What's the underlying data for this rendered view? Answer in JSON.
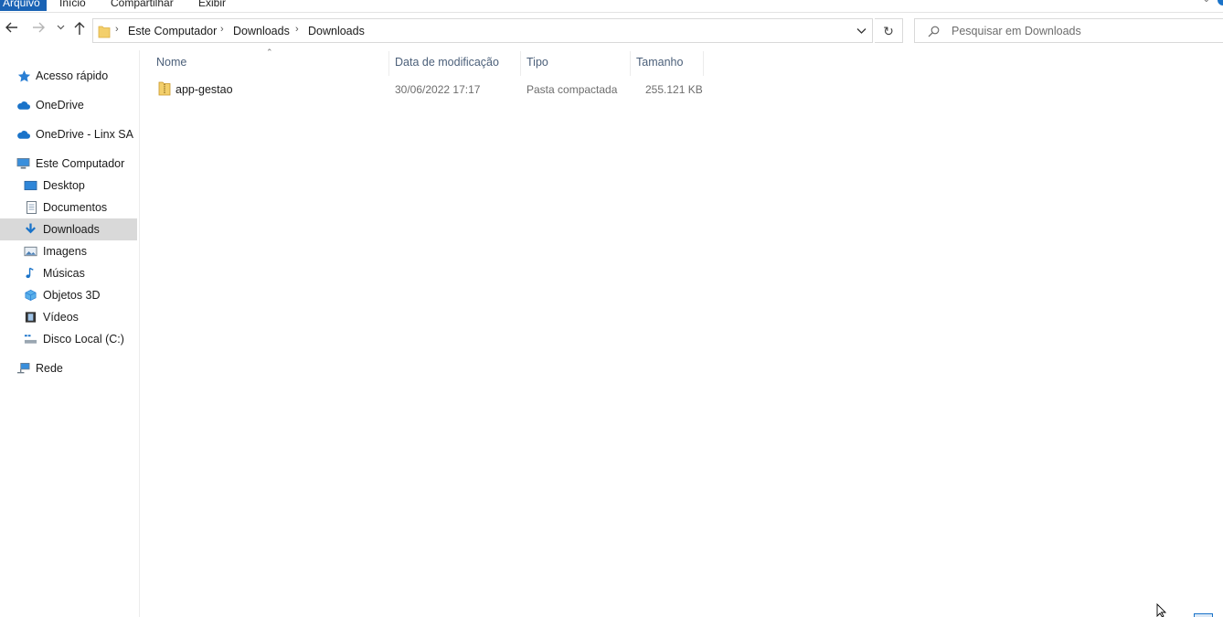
{
  "ribbon": {
    "tabs": [
      {
        "label": "Arquivo",
        "active": true
      },
      {
        "label": "Início",
        "active": false
      },
      {
        "label": "Compartilhar",
        "active": false
      },
      {
        "label": "Exibir",
        "active": false
      }
    ],
    "accent": "#1a63b5"
  },
  "nav": {
    "back_icon": "arrow-left-icon",
    "forward_icon": "arrow-right-icon",
    "recent_icon": "chevron-down-icon",
    "up_icon": "arrow-up-icon"
  },
  "address": {
    "crumbs": [
      "Este Computador",
      "Downloads",
      "Downloads"
    ],
    "separator": "›",
    "dropdown_icon": "chevron-down-icon",
    "refresh_icon": "refresh-icon"
  },
  "search": {
    "placeholder": "Pesquisar em Downloads",
    "icon": "search-icon"
  },
  "sidebar": {
    "items": [
      {
        "label": "Acesso rápido",
        "icon": "star-icon"
      },
      {
        "label": "OneDrive",
        "icon": "cloud-icon"
      },
      {
        "label": "OneDrive - Linx SA",
        "icon": "cloud-icon"
      },
      {
        "label": "Este Computador",
        "icon": "computer-icon"
      },
      {
        "label": "Desktop",
        "icon": "desktop-icon"
      },
      {
        "label": "Documentos",
        "icon": "document-icon"
      },
      {
        "label": "Downloads",
        "icon": "download-icon",
        "selected": true
      },
      {
        "label": "Imagens",
        "icon": "image-icon"
      },
      {
        "label": "Músicas",
        "icon": "music-icon"
      },
      {
        "label": "Objetos 3D",
        "icon": "cube-icon"
      },
      {
        "label": "Vídeos",
        "icon": "film-icon"
      },
      {
        "label": "Disco Local (C:)",
        "icon": "drive-icon"
      },
      {
        "label": "Rede",
        "icon": "network-icon"
      }
    ]
  },
  "columns": {
    "name": "Nome",
    "date": "Data de modificação",
    "type": "Tipo",
    "size": "Tamanho"
  },
  "files": [
    {
      "name": "app-gestao",
      "date": "30/06/2022 17:17",
      "type": "Pasta compactada",
      "size": "255.121 KB",
      "icon": "zip-folder-icon"
    }
  ]
}
